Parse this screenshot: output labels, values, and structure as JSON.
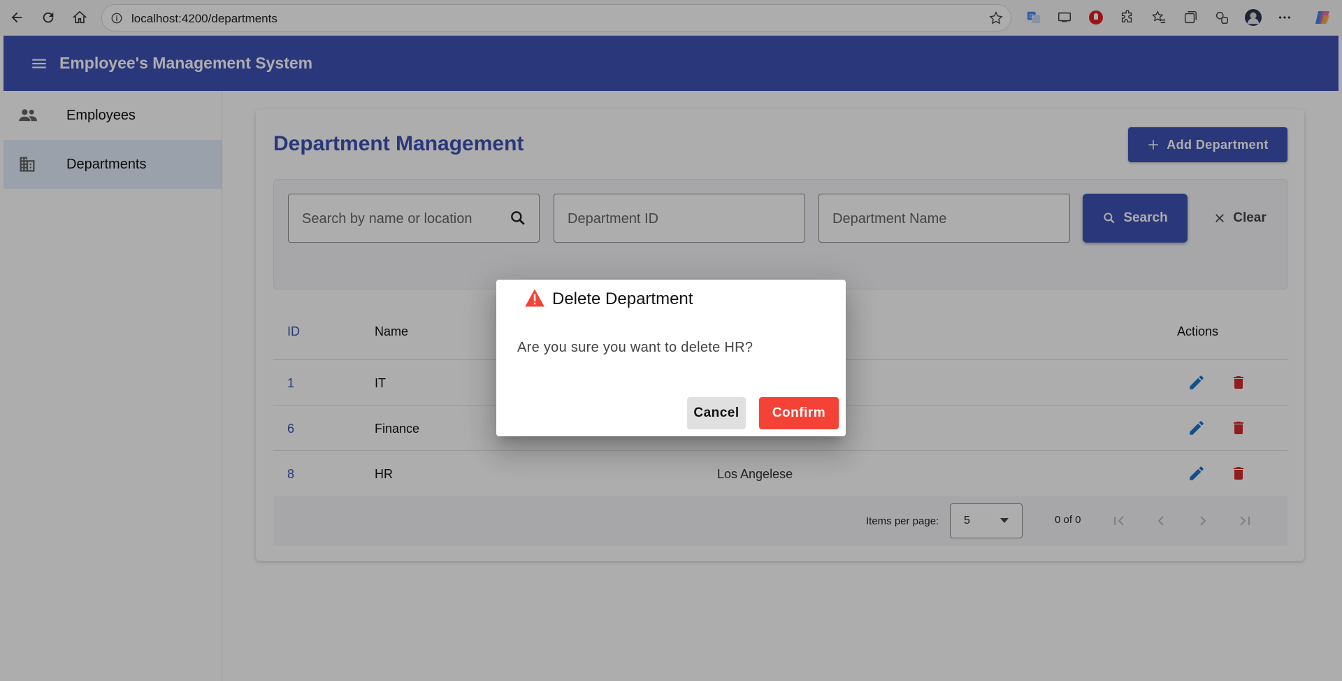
{
  "browser": {
    "url": "localhost:4200/departments"
  },
  "app": {
    "title": "Employee's Management System"
  },
  "sidebar": {
    "items": [
      {
        "label": "Employees",
        "icon": "people-icon",
        "active": false
      },
      {
        "label": "Departments",
        "icon": "building-icon",
        "active": true
      }
    ]
  },
  "page": {
    "title": "Department Management",
    "add_button": "Add Department"
  },
  "filters": {
    "search_placeholder": "Search by name or location",
    "dept_id_placeholder": "Department ID",
    "dept_name_placeholder": "Department Name",
    "search_button": "Search",
    "clear_button": "Clear"
  },
  "table": {
    "headers": {
      "id": "ID",
      "name": "Name",
      "actions": "Actions"
    },
    "rows": [
      {
        "id": "1",
        "name": "IT",
        "location": ""
      },
      {
        "id": "6",
        "name": "Finance",
        "location": ""
      },
      {
        "id": "8",
        "name": "HR",
        "location": "Los Angelese"
      }
    ]
  },
  "paginator": {
    "items_per_page_label": "Items per page:",
    "items_per_page_value": "5",
    "range_label": "0 of 0"
  },
  "dialog": {
    "title": "Delete Department",
    "message": "Are you sure you want to delete HR?",
    "cancel": "Cancel",
    "confirm": "Confirm"
  },
  "colors": {
    "primary": "#3f51b5",
    "warn": "#f44336",
    "edit_icon": "#1e73c9",
    "delete_icon": "#d32f2f"
  }
}
